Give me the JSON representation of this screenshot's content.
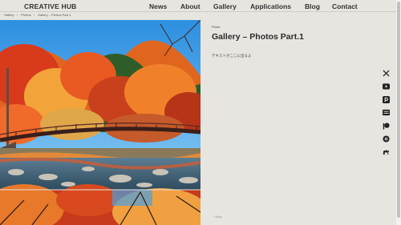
{
  "site": {
    "logo": "CREATIVE HUB"
  },
  "nav": {
    "items": [
      {
        "label": "News"
      },
      {
        "label": "About"
      },
      {
        "label": "Gallery"
      },
      {
        "label": "Applications"
      },
      {
        "label": "Blog"
      },
      {
        "label": "Contact"
      }
    ]
  },
  "breadcrumb": {
    "items": [
      "Gallery",
      "Photos",
      "Gallery – Photos Part.1"
    ]
  },
  "post": {
    "tag": "Photo",
    "title": "Gallery – Photos Part.1",
    "body": "テキストがここに出るよ",
    "blog_link": "‹ Blog"
  },
  "social": {
    "icons": [
      "x-icon",
      "youtube-icon",
      "pixiv-icon",
      "niconico-icon",
      "patreon-icon",
      "kofi-icon",
      "camel-icon"
    ]
  },
  "colors": {
    "background": "#e7e5e0",
    "text": "#2b2b2b",
    "sky": "#3aa0e8",
    "autumn_red": "#d8421f",
    "autumn_orange": "#f08a24"
  }
}
